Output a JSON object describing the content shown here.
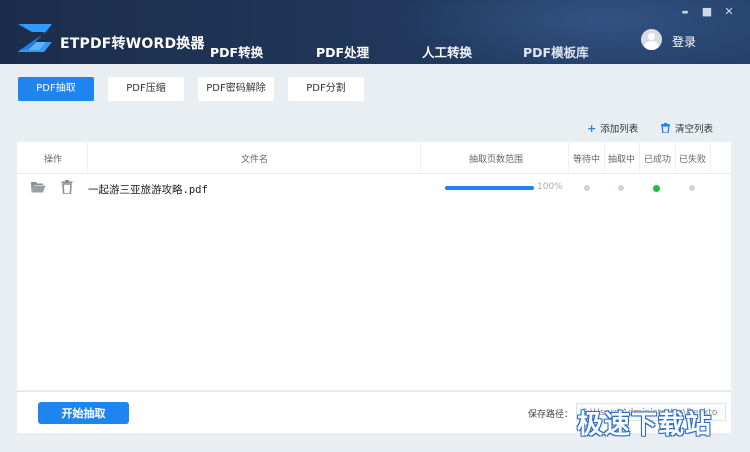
{
  "app": {
    "title": "ETPDF转WORD换器"
  },
  "window_controls": {
    "minimize": "▬",
    "maximize": "■",
    "close": "✕"
  },
  "nav": {
    "tabs": [
      "PDF转换",
      "PDF处理",
      "人工转换",
      "PDF模板库"
    ],
    "active": "PDF处理"
  },
  "user": {
    "login_label": "登录"
  },
  "subtabs": {
    "items": [
      "PDF抽取",
      "PDF压缩",
      "PDF密码解除",
      "PDF分割"
    ],
    "active": "PDF抽取"
  },
  "toolbar": {
    "add_label": "添加列表",
    "clear_label": "清空列表"
  },
  "table": {
    "headers": [
      "操作",
      "文件名",
      "抽取页数范围",
      "等待中",
      "抽取中",
      "已成功",
      "已失败"
    ],
    "rows": [
      {
        "filename": "一起游三亚旅游攻略.pdf",
        "progress": 1.0,
        "progress_label": "100%",
        "status": "已成功"
      }
    ]
  },
  "footer": {
    "start_label": "开始抽取",
    "save_path_label": "保存路径：",
    "save_path_value": "C:\\Users\\Administrator\\Deskto"
  },
  "watermark": "极速下载站",
  "colors": {
    "accent": "#1e84f0",
    "success": "#19c23a",
    "header_bg": "#1b2d4b"
  }
}
